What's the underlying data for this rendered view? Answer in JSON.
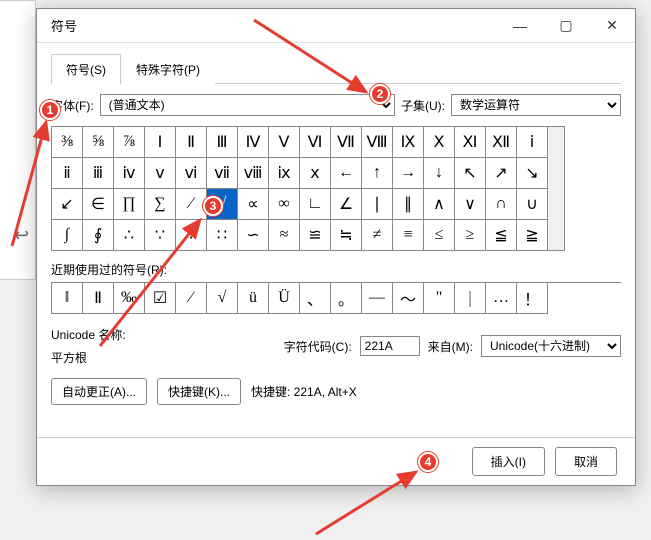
{
  "outer_glyph": "↩",
  "title": "符号",
  "winbtns": {
    "min": "—",
    "max": "▢",
    "close": "✕"
  },
  "tabs": {
    "symbols": "符号(S)",
    "special": "特殊字符(P)"
  },
  "font_label": "字体(F):",
  "font_value": "(普通文本)",
  "subset_label": "子集(U):",
  "subset_value": "数学运算符",
  "grid": [
    "⅜",
    "⅝",
    "⅞",
    "Ⅰ",
    "Ⅱ",
    "Ⅲ",
    "Ⅳ",
    "Ⅴ",
    "Ⅵ",
    "Ⅶ",
    "Ⅷ",
    "Ⅸ",
    "Ⅹ",
    "Ⅺ",
    "Ⅻ",
    "ⅰ",
    "ⅱ",
    "ⅲ",
    "ⅳ",
    "ⅴ",
    "ⅵ",
    "ⅶ",
    "ⅷ",
    "ⅸ",
    "ⅹ",
    "←",
    "↑",
    "→",
    "↓",
    "↖",
    "↗",
    "↘",
    "↙",
    "∈",
    "∏",
    "∑",
    "∕",
    "√",
    "∝",
    "∞",
    "∟",
    "∠",
    "∣",
    "∥",
    "∧",
    "∨",
    "∩",
    "∪",
    "∫",
    "∮",
    "∴",
    "∵",
    "∶",
    "∷",
    "∽",
    "≈",
    "≌",
    "≒",
    "≠",
    "≡",
    "≤",
    "≥",
    "≦",
    "≧"
  ],
  "selected_index": 37,
  "recent_label": "近期使用过的符号(R):",
  "recent": [
    "‖",
    "Ⅱ",
    "‰",
    "☑",
    "∕",
    "√",
    "ü",
    "Ü",
    "、",
    "。",
    "—",
    "～",
    "\"",
    "｜",
    "…",
    "！"
  ],
  "unicode_name_label": "Unicode 名称:",
  "unicode_name_value": "平方根",
  "charcode_label": "字符代码(C):",
  "charcode_value": "221A",
  "from_label": "来自(M):",
  "from_value": "Unicode(十六进制)",
  "btn_autocorrect": "自动更正(A)...",
  "btn_shortcut": "快捷键(K)...",
  "shortcut_text": "快捷键: 221A, Alt+X",
  "btn_insert": "插入(I)",
  "btn_cancel": "取消",
  "markers": {
    "1": "1",
    "2": "2",
    "3": "3",
    "4": "4"
  }
}
